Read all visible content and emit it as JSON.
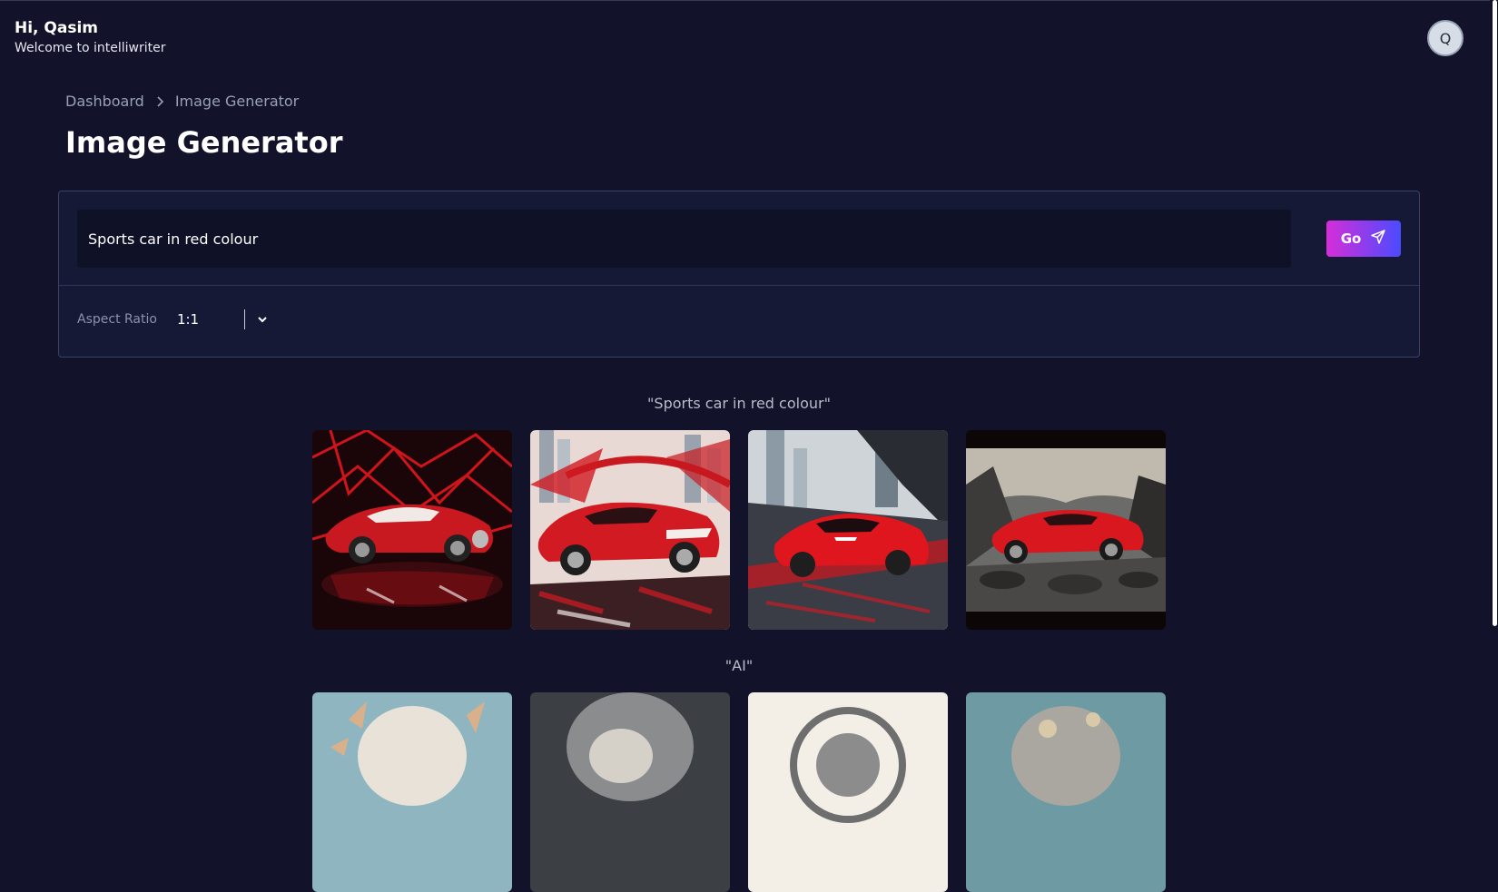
{
  "header": {
    "greeting": "Hi, Qasim",
    "welcome": "Welcome to intelliwriter",
    "avatar_initial": "Q"
  },
  "breadcrumb": {
    "items": [
      "Dashboard",
      "Image Generator"
    ]
  },
  "page_title": "Image Generator",
  "prompt": {
    "value": "Sports car in red colour",
    "go_label": "Go"
  },
  "aspect_ratio": {
    "label": "Aspect Ratio",
    "value": "1:1"
  },
  "results": [
    {
      "caption": "\"Sports car in red colour\"",
      "images": [
        "red-sports-car-geometric",
        "red-sports-car-city",
        "red-sports-car-motion",
        "red-sports-car-rocks"
      ]
    },
    {
      "caption": "\"AI\"",
      "images": [
        "ai-portrait-1",
        "ai-portrait-2",
        "ai-portrait-3",
        "ai-portrait-4"
      ]
    }
  ],
  "colors": {
    "background": "#12132a",
    "panel": "#151936",
    "accent_start": "#d52ed8",
    "accent_end": "#4b4bff"
  }
}
